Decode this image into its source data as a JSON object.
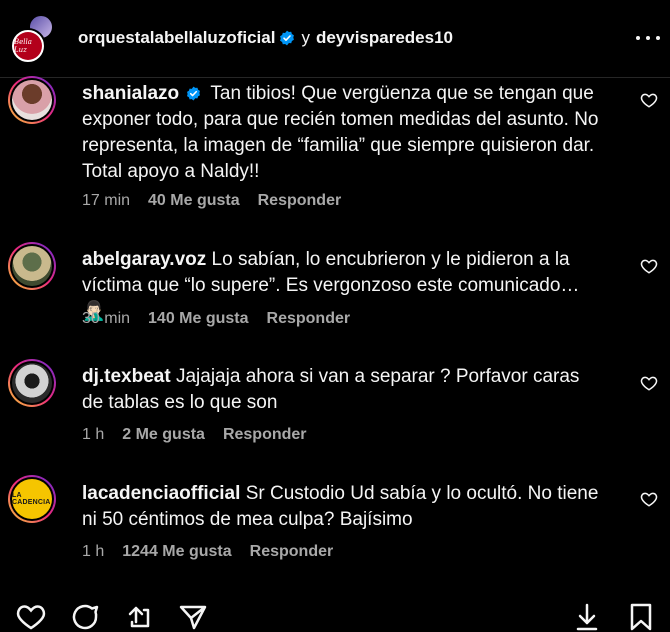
{
  "header": {
    "account1": "orquestalabellaluzoficial",
    "joiner": "y",
    "account2": "deyvisparedes10",
    "logo_text": "Bella Luz"
  },
  "comments": [
    {
      "user": "shanialazo",
      "verified": true,
      "text": "Tan tibios! Que vergüenza que se tengan que exponer todo, para que recién tomen medidas del asunto. No representa, la imagen de “familia” que siempre quisieron dar. Total apoyo a Naldy!!",
      "time": "17 min",
      "likes": "40 Me gusta",
      "reply": "Responder"
    },
    {
      "user": "abelgaray.voz",
      "verified": false,
      "text": "Lo sabían, lo encubrieron y le pidieron a la víctima que “lo supere”. Es vergonzoso este comunicado… 🤦🏻‍♂️",
      "time": "30 min",
      "likes": "140 Me gusta",
      "reply": "Responder"
    },
    {
      "user": "dj.texbeat",
      "verified": false,
      "text": "Jajajaja ahora si van a separar ? Porfavor caras de tablas es lo que son",
      "time": "1 h",
      "likes": "2 Me gusta",
      "reply": "Responder"
    },
    {
      "user": "lacadenciaofficial",
      "verified": false,
      "avatar_text": "LA CADENCIA",
      "text": "Sr Custodio Ud sabía y lo ocultó. No tiene ni 50 céntimos de mea culpa? Bajísimo",
      "time": "1 h",
      "likes": "1244 Me gusta",
      "reply": "Responder"
    }
  ],
  "colors": {
    "background": "#000000",
    "text": "#f5f5f5",
    "muted": "#a8a8a8",
    "verified": "#0095f6"
  },
  "icons": [
    "more-icon",
    "heart-icon",
    "comment-icon",
    "share-icon",
    "send-icon",
    "download-icon",
    "bookmark-icon"
  ]
}
